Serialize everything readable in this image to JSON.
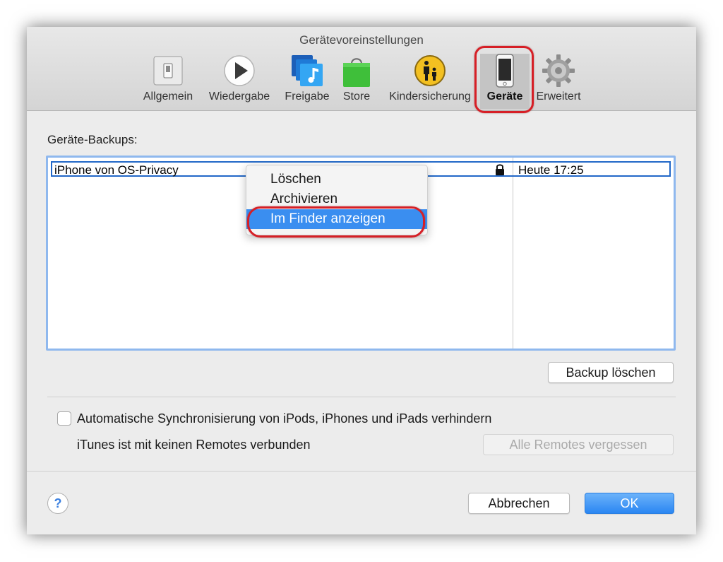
{
  "window": {
    "title": "Gerätevoreinstellungen"
  },
  "toolbar": {
    "items": [
      {
        "label": "Allgemein",
        "icon": "switch-icon"
      },
      {
        "label": "Wiedergabe",
        "icon": "play-icon"
      },
      {
        "label": "Freigabe",
        "icon": "music-sharing-icon"
      },
      {
        "label": "Store",
        "icon": "shopping-bag-icon"
      },
      {
        "label": "Kindersicherung",
        "icon": "parental-controls-icon"
      },
      {
        "label": "Geräte",
        "icon": "iphone-icon"
      },
      {
        "label": "Erweitert",
        "icon": "gear-icon"
      }
    ],
    "active": "Geräte"
  },
  "backups": {
    "section_label": "Geräte-Backups:",
    "rows": [
      {
        "name": "iPhone von OS-Privacy",
        "locked": true,
        "date": "Heute 17:25"
      }
    ]
  },
  "context_menu": {
    "items": [
      "Löschen",
      "Archivieren",
      "Im Finder anzeigen"
    ],
    "highlighted": "Im Finder anzeigen"
  },
  "buttons": {
    "delete_backup": "Backup löschen",
    "forget_remotes": "Alle Remotes vergessen",
    "cancel": "Abbrechen",
    "ok": "OK"
  },
  "options": {
    "prevent_sync_label": "Automatische Synchronisierung von iPods, iPhones und iPads verhindern",
    "prevent_sync_checked": false,
    "remotes_status": "iTunes ist mit keinen Remotes verbunden"
  },
  "help": {
    "glyph": "?"
  },
  "colors": {
    "accent": "#3a8ef0",
    "annotation": "#d61f26",
    "selection_border": "#2268c8"
  }
}
